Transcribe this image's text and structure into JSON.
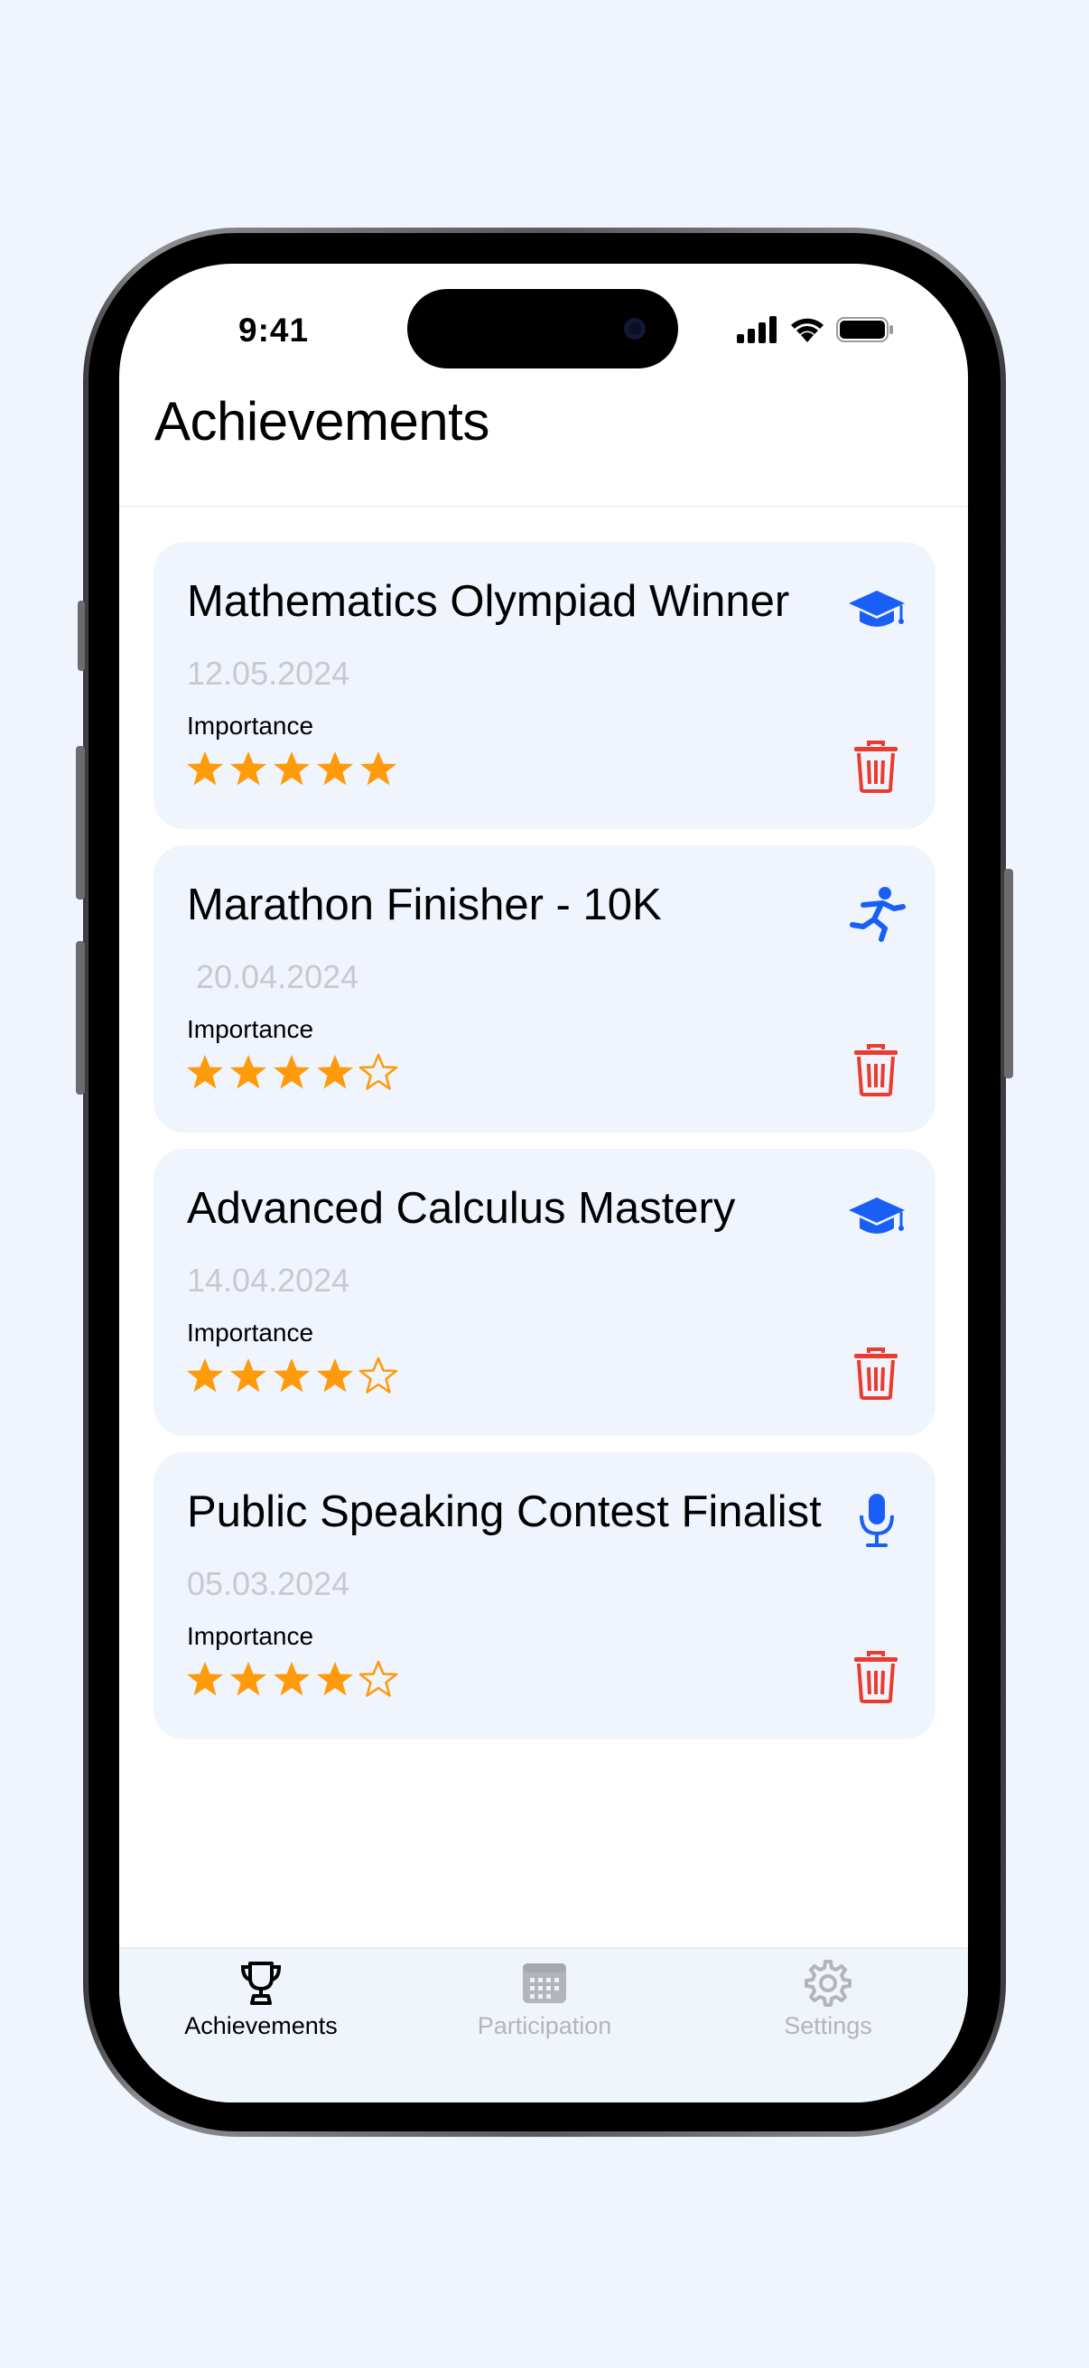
{
  "status_bar": {
    "time": "9:41"
  },
  "header": {
    "title": "Achievements"
  },
  "achievements": [
    {
      "title": "Mathematics Olympiad Winner",
      "date": "12.05.2024",
      "importance_label": "Importance",
      "rating": 5,
      "icon": "graduation-cap-icon"
    },
    {
      "title": "Marathon Finisher - 10K",
      "date": " 20.04.2024",
      "importance_label": "Importance",
      "rating": 4,
      "icon": "runner-icon"
    },
    {
      "title": "Advanced Calculus Mastery",
      "date": "14.04.2024",
      "importance_label": "Importance",
      "rating": 4,
      "icon": "graduation-cap-icon"
    },
    {
      "title": "Public Speaking Contest Finalist",
      "date": "05.03.2024",
      "importance_label": "Importance",
      "rating": 4,
      "icon": "microphone-icon"
    }
  ],
  "tabs": [
    {
      "label": "Achievements",
      "icon": "trophy-icon",
      "active": true
    },
    {
      "label": "Participation",
      "icon": "calendar-icon",
      "active": false
    },
    {
      "label": "Settings",
      "icon": "gear-icon",
      "active": false
    }
  ],
  "colors": {
    "accent_blue": "#1a5ff5",
    "star_orange": "#ff9a0a",
    "delete_red": "#ea3b2f",
    "card_bg": "#eff4fd",
    "inactive_tab": "#b3b5bb"
  }
}
